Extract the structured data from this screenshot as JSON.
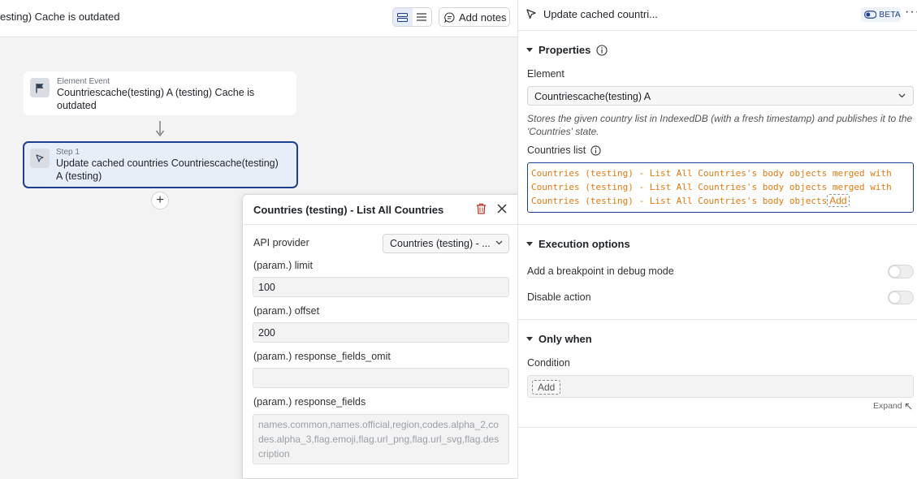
{
  "topbar": {
    "title": "esting)  Cache is outdated",
    "add_notes_label": "Add notes"
  },
  "canvas": {
    "event_node": {
      "label": "Element Event",
      "text": "Countriescache(testing) A (testing) Cache is outdated"
    },
    "step_node": {
      "label": "Step 1",
      "text": "Update cached countries Countriescache(testing) A (testing)"
    },
    "add_step_symbol": "+"
  },
  "popover": {
    "title": "Countries (testing) - List All Countries",
    "fields": {
      "api_provider_label": "API provider",
      "api_provider_value": "Countries (testing) - ...",
      "limit_label": "(param.) limit",
      "limit_value": "100",
      "offset_label": "(param.) offset",
      "offset_value": "200",
      "omit_label": "(param.) response_fields_omit",
      "omit_value": "",
      "fields_label": "(param.) response_fields",
      "fields_placeholder": "names.common,names.official,region,codes.alpha_2,codes.alpha_3,flag.emoji,flag.url_png,flag.url_svg,flag.description"
    }
  },
  "panel": {
    "title": "Update cached countri...",
    "beta_label": "BETA",
    "more_label": "···",
    "properties": {
      "section_title": "Properties",
      "element_label": "Element",
      "element_value": "Countriescache(testing) A",
      "description": "Stores the given country list in IndexedDB (with a fresh timestamp) and publishes it to the 'Countries' state.",
      "countries_list_label": "Countries list",
      "countries_list_value": "Countries (testing) - List All Countries's body objects merged with Countries (testing) - List All Countries's body objects merged with Countries (testing) - List All Countries's body objects",
      "countries_list_add": "Add"
    },
    "execution": {
      "section_title": "Execution options",
      "breakpoint_label": "Add a breakpoint in debug mode",
      "breakpoint_on": false,
      "disable_label": "Disable action",
      "disable_on": false
    },
    "only_when": {
      "section_title": "Only when",
      "condition_label": "Condition",
      "condition_add": "Add",
      "expand_label": "Expand"
    }
  },
  "colors": {
    "accent": "#1d3f8f",
    "code_orange": "#e07a10",
    "delete_red": "#c0392b"
  }
}
